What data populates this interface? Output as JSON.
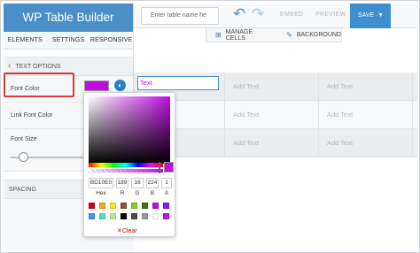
{
  "app": {
    "title": "WP Table Builder"
  },
  "sidebar": {
    "tabs": [
      {
        "label": "ELEMENTS"
      },
      {
        "label": "SETTINGS"
      },
      {
        "label": "RESPONSIVE"
      }
    ],
    "section_title": "TEXT OPTIONS",
    "options": {
      "font_color": "Font Color",
      "link_font_color": "Link Font Color",
      "font_size": "Font Size"
    },
    "spacing_title": "SPACING",
    "font_color_value": "#bd10e0"
  },
  "toolbar": {
    "table_name_placeholder": "Enter table name he",
    "embed": "EMBED",
    "preview": "PREVIEW",
    "save": "SAVE"
  },
  "subbar": {
    "manage_cells": "MANAGE CELLS",
    "background": "BACKGROUND"
  },
  "table": {
    "editing_cell": "Text",
    "rows": [
      [
        "",
        "Add Text",
        "Add Text"
      ],
      [
        "",
        "Add Text",
        "Add Text"
      ],
      [
        "",
        "Add Text",
        "Add Text"
      ]
    ]
  },
  "color_picker": {
    "hex": "BD10E0",
    "r": "189",
    "g": "16",
    "b": "224",
    "a": "1",
    "labels": {
      "hex": "Hex",
      "r": "R",
      "g": "G",
      "b": "B",
      "a": "A"
    },
    "presets": [
      "#d0021b",
      "#f5a623",
      "#f8e71c",
      "#8b572a",
      "#7ed321",
      "#417505",
      "#bd10e0",
      "#9013fe",
      "#4a90e2",
      "#50e3c2",
      "#b8e986",
      "#000000",
      "#4a4a4a",
      "#9b9b9b",
      "#ffffff",
      "#bd10e0"
    ],
    "clear_label": "Clear",
    "current": "#bd10e0"
  }
}
